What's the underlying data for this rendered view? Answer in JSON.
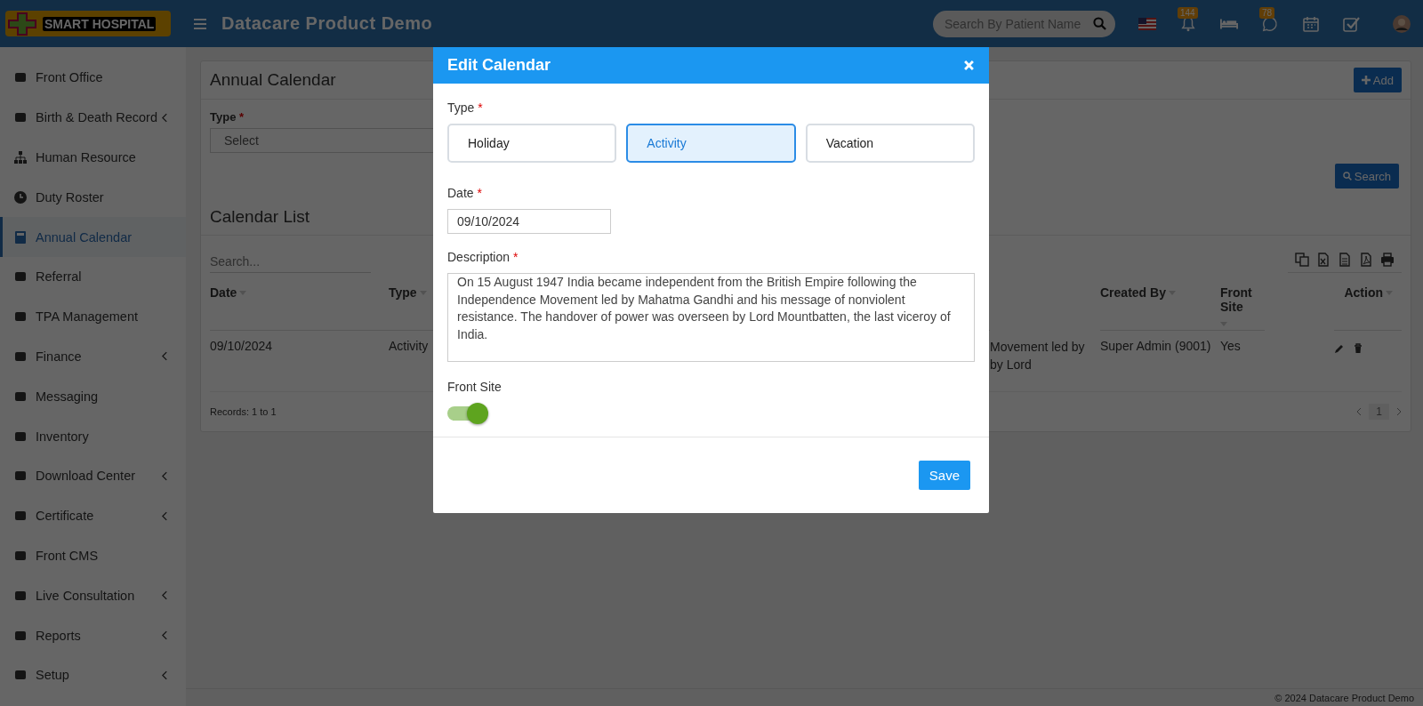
{
  "header": {
    "logo_text": "SMART HOSPITAL",
    "title": "Datacare Product Demo",
    "search": {
      "placeholder": "Search By Patient Name"
    },
    "notifications_badge": "144",
    "whatsapp_badge": "78"
  },
  "sidebar": {
    "items": [
      {
        "label": "Front Office",
        "expandable": false,
        "selected": false
      },
      {
        "label": "Birth & Death Record",
        "expandable": true,
        "selected": false
      },
      {
        "label": "Human Resource",
        "expandable": false,
        "selected": false
      },
      {
        "label": "Duty Roster",
        "expandable": false,
        "selected": false
      },
      {
        "label": "Annual Calendar",
        "expandable": false,
        "selected": true
      },
      {
        "label": "Referral",
        "expandable": false,
        "selected": false
      },
      {
        "label": "TPA Management",
        "expandable": false,
        "selected": false
      },
      {
        "label": "Finance",
        "expandable": true,
        "selected": false
      },
      {
        "label": "Messaging",
        "expandable": false,
        "selected": false
      },
      {
        "label": "Inventory",
        "expandable": false,
        "selected": false
      },
      {
        "label": "Download Center",
        "expandable": true,
        "selected": false
      },
      {
        "label": "Certificate",
        "expandable": true,
        "selected": false
      },
      {
        "label": "Front CMS",
        "expandable": false,
        "selected": false
      },
      {
        "label": "Live Consultation",
        "expandable": true,
        "selected": false
      },
      {
        "label": "Reports",
        "expandable": true,
        "selected": false
      },
      {
        "label": "Setup",
        "expandable": true,
        "selected": false
      }
    ]
  },
  "page": {
    "title": "Annual Calendar",
    "add_button": "Add",
    "filter": {
      "label": "Type",
      "required_mark": "*",
      "value": "Select"
    },
    "search_button": "Search",
    "list_title": "Calendar List",
    "list_search": {
      "placeholder": "Search..."
    },
    "table": {
      "columns": [
        {
          "label": "Date"
        },
        {
          "label": "Type"
        },
        {
          "label": "Created By"
        },
        {
          "label": "Front Site"
        },
        {
          "label": "Action"
        }
      ],
      "rows": [
        {
          "date": "09/10/2024",
          "type": "Activity",
          "column_3": [
            "Movement led by",
            "by Lord"
          ],
          "created_by": "Super Admin (9001)",
          "front_site": "Yes"
        }
      ]
    },
    "records": "Records: 1 to 1",
    "page_number": "1"
  },
  "modal": {
    "title": "Edit Calendar",
    "type_label": {
      "text": "Type",
      "required_mark": "*"
    },
    "types": [
      {
        "label": "Holiday",
        "selected": false
      },
      {
        "label": "Activity",
        "selected": true
      },
      {
        "label": "Vacation",
        "selected": false
      }
    ],
    "date_label": {
      "text": "Date",
      "required_mark": "*"
    },
    "date": "09/10/2024",
    "description_label": {
      "text": "Description",
      "required_mark": "*"
    },
    "description": "On 15 August 1947 India became independent from the British Empire following the Independence Movement led by Mahatma Gandhi and his message of nonviolent resistance. The handover of power was overseen by Lord Mountbatten, the last viceroy of India.",
    "front_site_label": "Front Site",
    "front_site": {
      "on": true
    },
    "save_button": "Save"
  },
  "footer": "© 2024 Datacare Product Demo"
}
